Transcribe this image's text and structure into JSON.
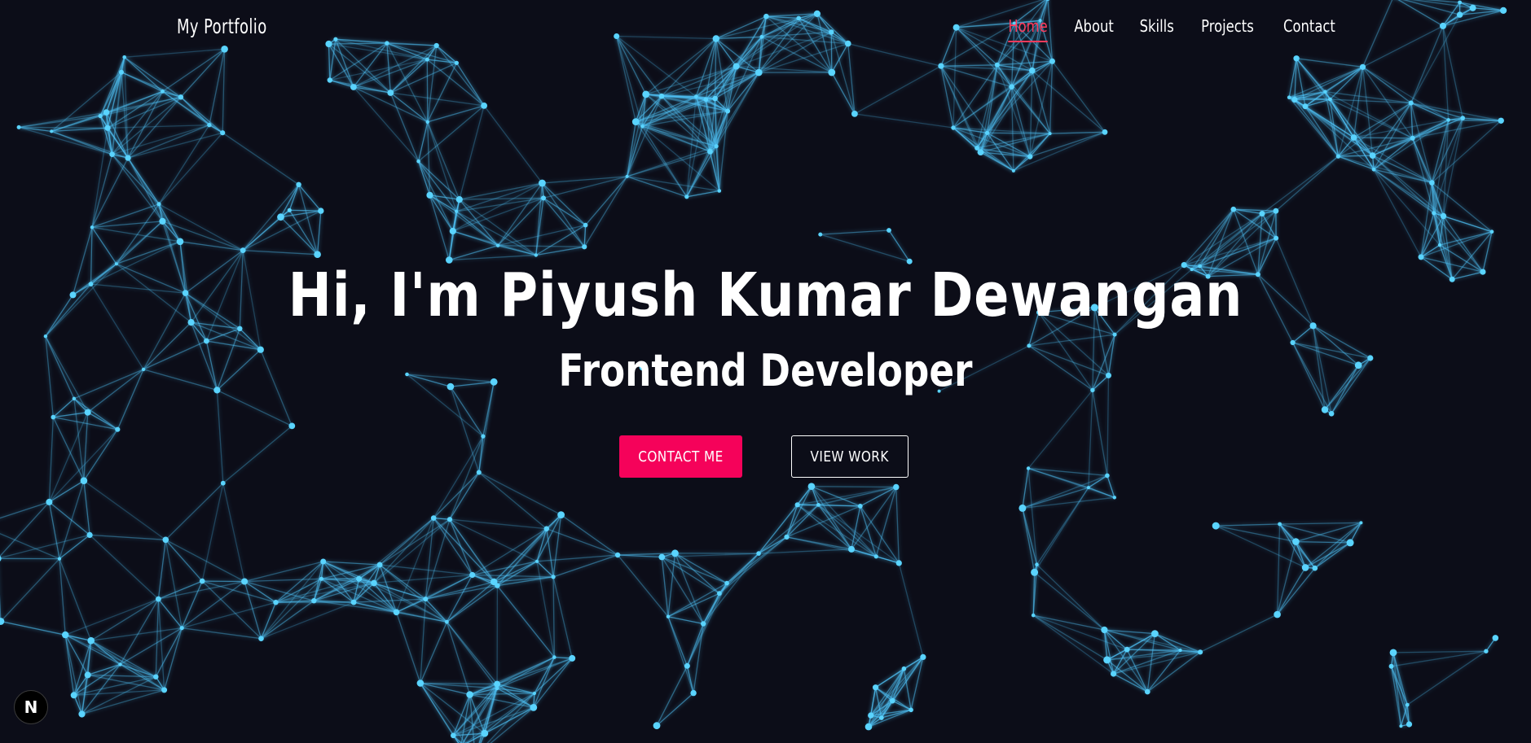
{
  "header": {
    "logo": "My Portfolio",
    "nav": [
      {
        "label": "Home",
        "active": true
      },
      {
        "label": "About",
        "active": false
      },
      {
        "label": "Skills",
        "active": false
      },
      {
        "label": "Projects",
        "active": false
      },
      {
        "label": "Contact",
        "active": false
      }
    ]
  },
  "hero": {
    "title": "Hi, I'm Piyush Kumar Dewangan",
    "subtitle": "Frontend Developer",
    "primary_button": "CONTACT ME",
    "secondary_button": "VIEW WORK"
  },
  "dev_badge": {
    "letter": "N",
    "icon": "nextjs-icon"
  },
  "colors": {
    "background": "#0c0d18",
    "accent": "#f5025a",
    "nav_active": "#ff3b5c",
    "network_line": "#4fc3f7",
    "network_node": "#5ad4ff"
  }
}
